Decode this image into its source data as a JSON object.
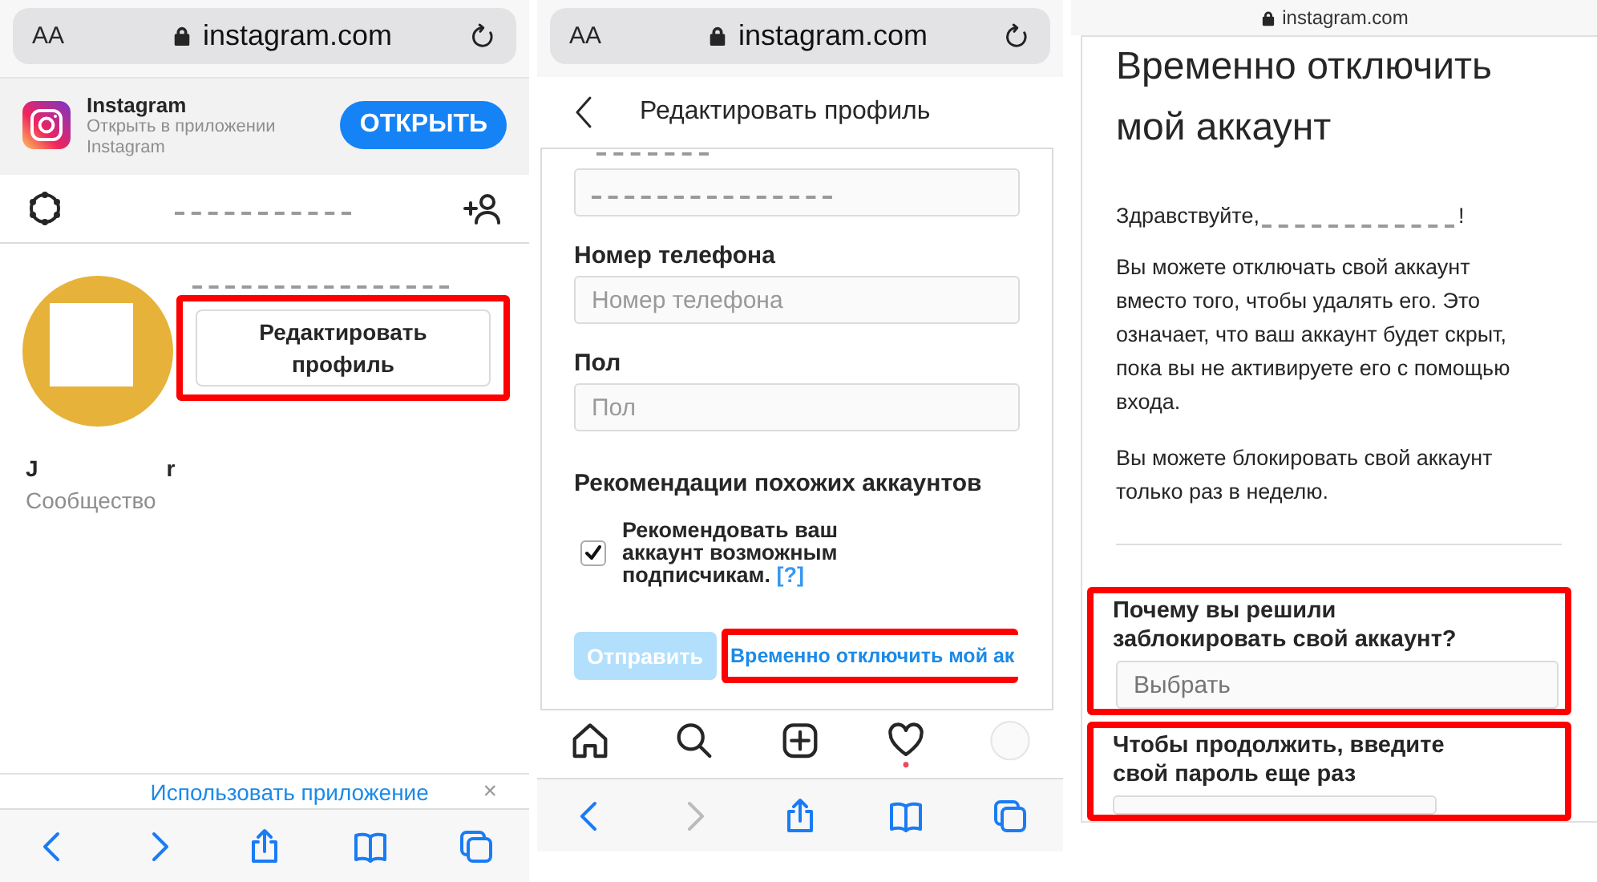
{
  "profile_screen": {
    "browser": {
      "text_size_button": "AA",
      "address": "instagram.com"
    },
    "app_banner": {
      "app_name": "Instagram",
      "subtitle": "Открыть в приложении Instagram",
      "open_button": "ОТКРЫТЬ"
    },
    "edit_button": {
      "label": "Редактировать профиль",
      "highlighted": true
    },
    "name_fragments": [
      "J",
      "r"
    ],
    "category": "Сообщество",
    "bottom_banner": {
      "text": "Использовать приложение",
      "close": "×"
    },
    "toolbar": [
      {
        "kind": "back",
        "disabled": false
      },
      {
        "kind": "forward",
        "disabled": false
      },
      {
        "kind": "share",
        "disabled": false
      },
      {
        "kind": "bookmarks",
        "disabled": false
      },
      {
        "kind": "tabs",
        "disabled": false
      }
    ]
  },
  "edit_screen": {
    "browser": {
      "text_size_button": "AA",
      "address": "instagram.com"
    },
    "title": "Редактировать профиль",
    "fields": [
      {
        "label": "Номер телефона",
        "placeholder": "Номер телефона"
      },
      {
        "label": "Пол",
        "placeholder": "Пол"
      }
    ],
    "section_title": "Рекомендации похожих аккаунтов",
    "recommend": {
      "text": "Рекомендовать ваш аккаунт возможным подписчикам.",
      "help_link": "[?]",
      "checked": true
    },
    "submit": {
      "label": "Отправить",
      "disabled": true
    },
    "deactivate_link": {
      "label": "Временно отключить мой ак",
      "highlighted": true
    },
    "nav": [
      {
        "kind": "home",
        "badge": false
      },
      {
        "kind": "search",
        "badge": false
      },
      {
        "kind": "add",
        "badge": false
      },
      {
        "kind": "activity",
        "badge": true
      },
      {
        "kind": "profile",
        "badge": false
      }
    ],
    "toolbar": [
      {
        "kind": "back",
        "disabled": false
      },
      {
        "kind": "forward",
        "disabled": true
      },
      {
        "kind": "share",
        "disabled": false
      },
      {
        "kind": "bookmarks",
        "disabled": false
      },
      {
        "kind": "tabs",
        "disabled": false
      }
    ]
  },
  "deactivate_screen": {
    "address": "instagram.com",
    "title": "Временно отключить мой аккаунт",
    "greeting": "Здравствуйте,",
    "greeting_end": "!",
    "paragraphs": [
      "Вы можете отключать свой аккаунт вместо того, чтобы удалять его. Это означает, что ваш аккаунт будет скрыт, пока вы не активируете его с помощью входа.",
      "Вы можете блокировать свой аккаунт только раз в неделю."
    ],
    "reason": {
      "label": "Почему вы решили заблокировать свой аккаунт?",
      "placeholder": "Выбрать",
      "highlighted": true
    },
    "password": {
      "label": "Чтобы продолжить, введите свой пароль еще раз",
      "highlighted": true
    }
  }
}
